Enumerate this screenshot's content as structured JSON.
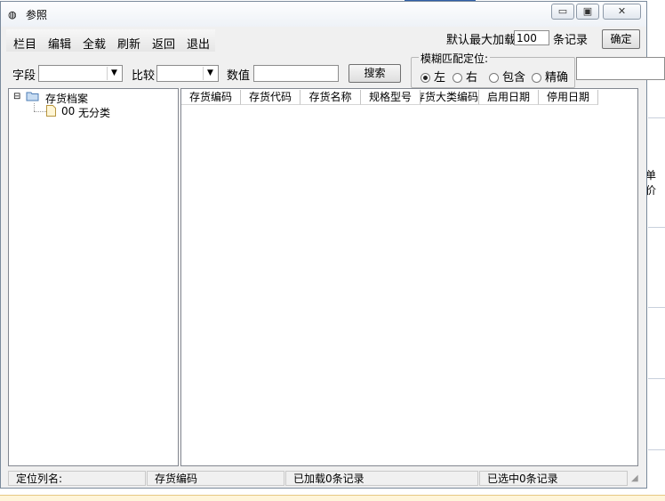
{
  "window": {
    "title": "参照"
  },
  "menu": [
    "栏目",
    "编辑",
    "全载",
    "刷新",
    "返回",
    "退出"
  ],
  "toolbar": {
    "max_load_label": "默认最大加载",
    "max_load_value": "100",
    "records_label": "条记录",
    "confirm_label": "确定"
  },
  "filter": {
    "field_label": "字段",
    "compare_label": "比较",
    "value_label": "数值",
    "search_label": "搜索"
  },
  "fuzzy": {
    "title": "模糊匹配定位:",
    "options": [
      "左",
      "右",
      "包含",
      "精确"
    ],
    "selected": "左"
  },
  "tree": {
    "root": "存货档案",
    "children": [
      {
        "code": "00",
        "name": "无分类"
      }
    ]
  },
  "grid": {
    "columns": [
      "存货编码",
      "存货代码",
      "存货名称",
      "规格型号",
      "存货大类编码",
      "启用日期",
      "停用日期"
    ]
  },
  "status": {
    "locate_col_label": "定位列名:",
    "locate_col_value": "存货编码",
    "loaded": "已加载0条记录",
    "selected": "已选中0条记录"
  },
  "background": {
    "side_label": "单价"
  }
}
